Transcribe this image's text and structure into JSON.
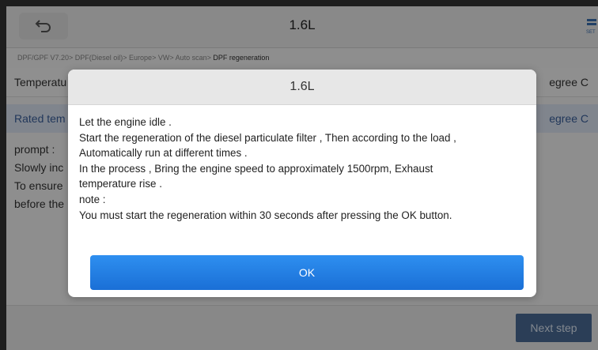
{
  "header": {
    "title": "1.6L",
    "settings_label": "SET"
  },
  "breadcrumb": {
    "path": "DPF/GPF V7.20> DPF(Diesel oil)> Europe> VW> Auto scan> ",
    "current": "DPF regeneration"
  },
  "rows": [
    {
      "label": "Temperatu",
      "unit": "egree C"
    },
    {
      "label": "Rated tem",
      "unit": "egree C"
    }
  ],
  "prompt_lines": [
    "prompt :",
    "Slowly inc",
    "To ensure",
    "before the"
  ],
  "next_step_label": "Next step",
  "dialog": {
    "title": "1.6L",
    "lines": [
      "Let the engine idle .",
      "Start the regeneration of the diesel particulate filter , Then according to the load ,",
      "Automatically run at different times .",
      "In the process , Bring the engine speed to approximately 1500rpm, Exhaust",
      "temperature rise .",
      "note :",
      "You must start the regeneration within 30 seconds after pressing the OK button."
    ],
    "ok_label": "OK"
  },
  "colors": {
    "accent": "#1a6fd6",
    "next_step": "#4a6c97",
    "highlight_row": "#dde6f3"
  }
}
